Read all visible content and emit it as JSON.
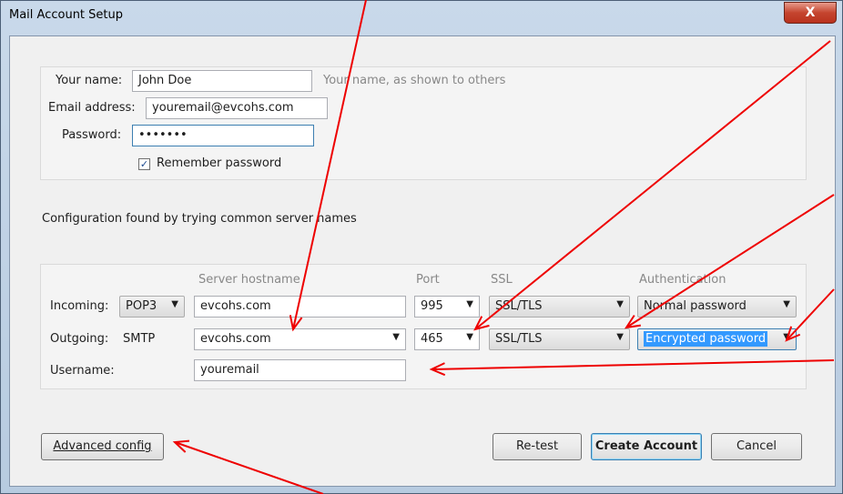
{
  "window": {
    "title": "Mail Account Setup",
    "close_glyph": "X"
  },
  "identity": {
    "name_label": "Your name:",
    "name_value": "John Doe",
    "name_hint": "Your name, as shown to others",
    "email_label": "Email address:",
    "email_value": "youremail@evcohs.com",
    "password_label": "Password:",
    "password_value": "•••••••",
    "remember_label": "Remember password",
    "remember_checked": true
  },
  "status": "Configuration found by trying common server names",
  "server": {
    "columns": {
      "hostname": "Server hostname",
      "port": "Port",
      "ssl": "SSL",
      "auth": "Authentication"
    },
    "incoming": {
      "label": "Incoming:",
      "protocol": "POP3",
      "hostname": "evcohs.com",
      "port": "995",
      "ssl": "SSL/TLS",
      "auth": "Normal password"
    },
    "outgoing": {
      "label": "Outgoing:",
      "protocol": "SMTP",
      "hostname": "evcohs.com",
      "port": "465",
      "ssl": "SSL/TLS",
      "auth": "Encrypted password"
    },
    "username_label": "Username:",
    "username_value": "youremail"
  },
  "buttons": {
    "advanced": "Advanced config",
    "retest": "Re-test",
    "create": "Create Account",
    "cancel": "Cancel"
  },
  "annotation": {
    "arrow_color": "#ee0000"
  }
}
